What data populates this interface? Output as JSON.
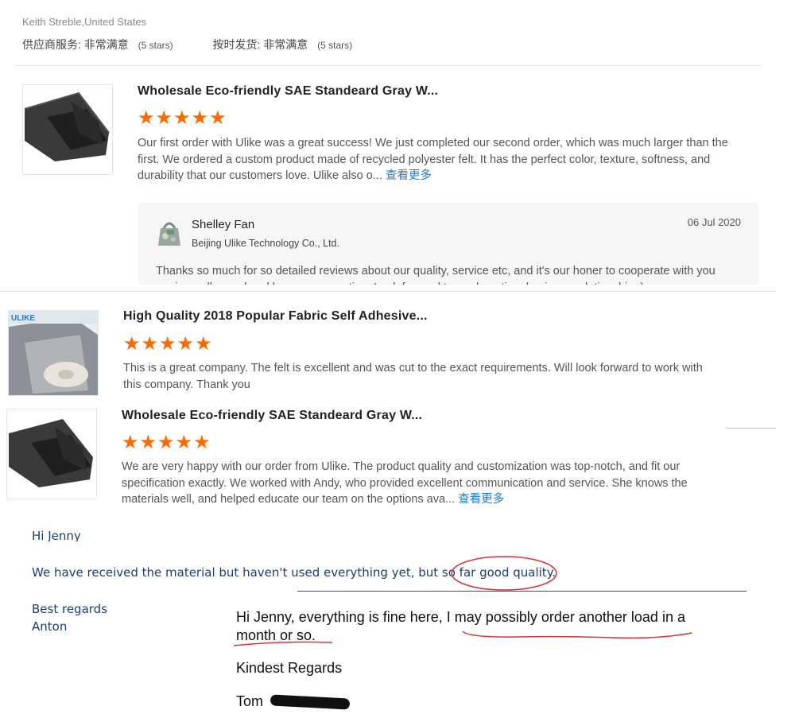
{
  "review1": {
    "reviewer": "Keith Streble,United States",
    "ratings": [
      {
        "label": "供应商服务:",
        "value": "非常满意",
        "stars": "(5 stars)"
      },
      {
        "label": "按时发货:",
        "value": "非常满意",
        "stars": "(5 stars)"
      }
    ]
  },
  "review2": {
    "product_title": "Wholesale Eco-friendly SAE Standeard Gray W...",
    "rating": 5,
    "stars_glyph": "★★★★★",
    "text": "Our first order with Ulike was a great success! We just completed our second order, which was much larger than the first. We ordered a custom product made of recycled polyester felt. It has the perfect color, texture, softness, and durability that our customers love. Ulike also o...",
    "more_label": "查看更多",
    "reply": {
      "name": "Shelley Fan",
      "company": "Beijing Ulike Technology Co., Ltd.",
      "date": "06 Jul 2020",
      "text": "Thanks so much for so detailed reviews about our quality, service etc, and it's our honer to cooperate with you again, really good and happy cooperation. Look forward to our long time business relationship :)"
    }
  },
  "review3": {
    "product_title": "High Quality 2018 Popular Fabric Self Adhesive...",
    "rating": 5,
    "stars_glyph": "★★★★★",
    "text": "This is a great company. The felt is excellent and was cut to the exact requirements. Will look forward to work with this company. Thank you",
    "thumb_brand": "ULIKE"
  },
  "review4": {
    "product_title": "Wholesale Eco-friendly SAE Standeard Gray W...",
    "rating": 5,
    "stars_glyph": "★★★★★",
    "text": "We are very happy with our order from Ulike. The product quality and customization was top-notch, and fit our specification exactly. We worked with Andy, who provided excellent communication and service. She knows the materials well, and helped educate our team on the options ava...",
    "more_label": "查看更多"
  },
  "email1": {
    "greeting": "Hi Jenny",
    "body": "We have received the material but haven't used everything yet, but so far good quality.",
    "signoff": "Best regards",
    "name": "Anton"
  },
  "email2": {
    "body": "Hi Jenny, everything is fine here, I may possibly order another load in a month or so.",
    "signoff": "Kindest Regards",
    "name": "Tom"
  },
  "colors": {
    "accent": "#ff6a00",
    "link": "#1e78d4",
    "email_blue": "#1f3c74",
    "annotation_red": "#d9303a"
  }
}
